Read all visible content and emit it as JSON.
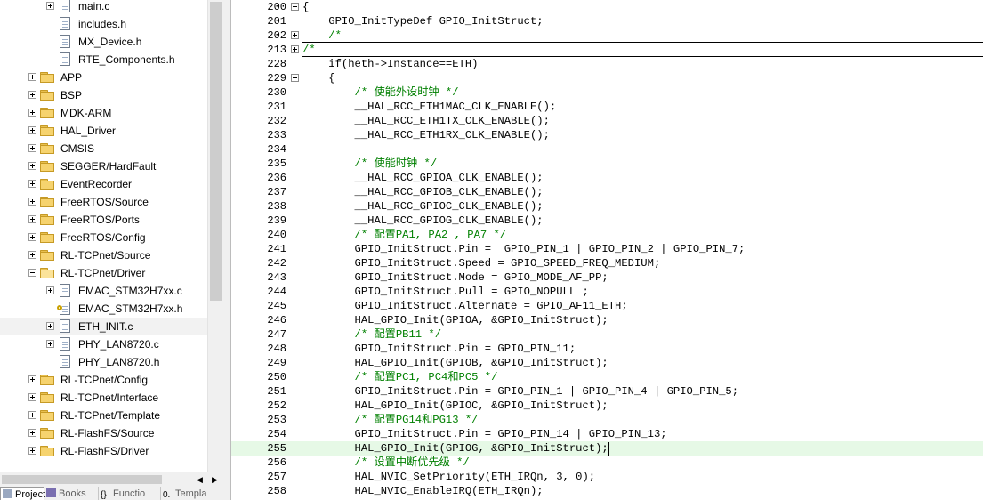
{
  "project_tree": {
    "rows": [
      {
        "indent": 2,
        "expander": "plus",
        "icon": "file",
        "label": "main.c"
      },
      {
        "indent": 2,
        "expander": "none",
        "icon": "file",
        "label": "includes.h"
      },
      {
        "indent": 2,
        "expander": "none",
        "icon": "file",
        "label": "MX_Device.h"
      },
      {
        "indent": 2,
        "expander": "none",
        "icon": "file",
        "label": "RTE_Components.h"
      },
      {
        "indent": 1,
        "expander": "plus",
        "icon": "folder",
        "label": "APP"
      },
      {
        "indent": 1,
        "expander": "plus",
        "icon": "folder",
        "label": "BSP"
      },
      {
        "indent": 1,
        "expander": "plus",
        "icon": "folder",
        "label": "MDK-ARM"
      },
      {
        "indent": 1,
        "expander": "plus",
        "icon": "folder",
        "label": "HAL_Driver"
      },
      {
        "indent": 1,
        "expander": "plus",
        "icon": "folder",
        "label": "CMSIS"
      },
      {
        "indent": 1,
        "expander": "plus",
        "icon": "folder",
        "label": "SEGGER/HardFault"
      },
      {
        "indent": 1,
        "expander": "plus",
        "icon": "folder",
        "label": "EventRecorder"
      },
      {
        "indent": 1,
        "expander": "plus",
        "icon": "folder",
        "label": "FreeRTOS/Source"
      },
      {
        "indent": 1,
        "expander": "plus",
        "icon": "folder",
        "label": "FreeRTOS/Ports"
      },
      {
        "indent": 1,
        "expander": "plus",
        "icon": "folder",
        "label": "FreeRTOS/Config"
      },
      {
        "indent": 1,
        "expander": "plus",
        "icon": "folder",
        "label": "RL-TCPnet/Source"
      },
      {
        "indent": 1,
        "expander": "minus",
        "icon": "folder-open",
        "label": "RL-TCPnet/Driver"
      },
      {
        "indent": 2,
        "expander": "plus",
        "icon": "file",
        "label": "EMAC_STM32H7xx.c"
      },
      {
        "indent": 2,
        "expander": "none",
        "icon": "file-key",
        "label": "EMAC_STM32H7xx.h"
      },
      {
        "indent": 2,
        "expander": "plus",
        "icon": "file",
        "label": "ETH_INIT.c",
        "selected": true
      },
      {
        "indent": 2,
        "expander": "plus",
        "icon": "file",
        "label": "PHY_LAN8720.c"
      },
      {
        "indent": 2,
        "expander": "none",
        "icon": "file",
        "label": "PHY_LAN8720.h"
      },
      {
        "indent": 1,
        "expander": "plus",
        "icon": "folder",
        "label": "RL-TCPnet/Config"
      },
      {
        "indent": 1,
        "expander": "plus",
        "icon": "folder",
        "label": "RL-TCPnet/Interface"
      },
      {
        "indent": 1,
        "expander": "plus",
        "icon": "folder",
        "label": "RL-TCPnet/Template"
      },
      {
        "indent": 1,
        "expander": "plus",
        "icon": "folder",
        "label": "RL-FlashFS/Source"
      },
      {
        "indent": 1,
        "expander": "plus",
        "icon": "folder",
        "label": "RL-FlashFS/Driver"
      }
    ]
  },
  "bottom_tabs": [
    {
      "label": "Project",
      "icon": "project-icon",
      "active": true
    },
    {
      "label": "Books",
      "icon": "books-icon"
    },
    {
      "label": "Functio",
      "icon": "functions-icon"
    },
    {
      "label": "Templa",
      "icon": "templates-icon"
    }
  ],
  "editor": {
    "current_line": "255",
    "lines": [
      {
        "num": "200",
        "fold": "minus",
        "text": "{"
      },
      {
        "num": "201",
        "text": "    GPIO_InitTypeDef GPIO_InitStruct;"
      },
      {
        "num": "202",
        "fold": "plus",
        "text": "    /*",
        "style": "comment",
        "separator_after": true
      },
      {
        "num": "213",
        "fold": "plus",
        "text": "/*",
        "style": "comment",
        "separator_after": true
      },
      {
        "num": "228",
        "text": "    if(heth->Instance==ETH)"
      },
      {
        "num": "229",
        "fold": "minus",
        "text": "    {"
      },
      {
        "num": "230",
        "text": "        /* 使能外设时钟 */",
        "style": "comment"
      },
      {
        "num": "231",
        "text": "        __HAL_RCC_ETH1MAC_CLK_ENABLE();"
      },
      {
        "num": "232",
        "text": "        __HAL_RCC_ETH1TX_CLK_ENABLE();"
      },
      {
        "num": "233",
        "text": "        __HAL_RCC_ETH1RX_CLK_ENABLE();"
      },
      {
        "num": "234",
        "text": ""
      },
      {
        "num": "235",
        "text": "        /* 使能时钟 */",
        "style": "comment"
      },
      {
        "num": "236",
        "text": "        __HAL_RCC_GPIOA_CLK_ENABLE();"
      },
      {
        "num": "237",
        "text": "        __HAL_RCC_GPIOB_CLK_ENABLE();"
      },
      {
        "num": "238",
        "text": "        __HAL_RCC_GPIOC_CLK_ENABLE();"
      },
      {
        "num": "239",
        "text": "        __HAL_RCC_GPIOG_CLK_ENABLE();"
      },
      {
        "num": "240",
        "text": "        /* 配置PA1, PA2 , PA7 */",
        "style": "comment"
      },
      {
        "num": "241",
        "text": "        GPIO_InitStruct.Pin =  GPIO_PIN_1 | GPIO_PIN_2 | GPIO_PIN_7;"
      },
      {
        "num": "242",
        "text": "        GPIO_InitStruct.Speed = GPIO_SPEED_FREQ_MEDIUM;"
      },
      {
        "num": "243",
        "text": "        GPIO_InitStruct.Mode = GPIO_MODE_AF_PP;"
      },
      {
        "num": "244",
        "text": "        GPIO_InitStruct.Pull = GPIO_NOPULL ;"
      },
      {
        "num": "245",
        "text": "        GPIO_InitStruct.Alternate = GPIO_AF11_ETH;"
      },
      {
        "num": "246",
        "text": "        HAL_GPIO_Init(GPIOA, &GPIO_InitStruct);"
      },
      {
        "num": "247",
        "text": "        /* 配置PB11 */",
        "style": "comment"
      },
      {
        "num": "248",
        "text": "        GPIO_InitStruct.Pin = GPIO_PIN_11;"
      },
      {
        "num": "249",
        "text": "        HAL_GPIO_Init(GPIOB, &GPIO_InitStruct);"
      },
      {
        "num": "250",
        "text": "        /* 配置PC1, PC4和PC5 */",
        "style": "comment"
      },
      {
        "num": "251",
        "text": "        GPIO_InitStruct.Pin = GPIO_PIN_1 | GPIO_PIN_4 | GPIO_PIN_5;"
      },
      {
        "num": "252",
        "text": "        HAL_GPIO_Init(GPIOC, &GPIO_InitStruct);"
      },
      {
        "num": "253",
        "text": "        /* 配置PG14和PG13 */",
        "style": "comment"
      },
      {
        "num": "254",
        "text": "        GPIO_InitStruct.Pin = GPIO_PIN_14 | GPIO_PIN_13;"
      },
      {
        "num": "255",
        "text": "        HAL_GPIO_Init(GPIOG, &GPIO_InitStruct);",
        "current": true
      },
      {
        "num": "256",
        "text": "        /* 设置中断优先级 */",
        "style": "comment"
      },
      {
        "num": "257",
        "text": "        HAL_NVIC_SetPriority(ETH_IRQn, 3, 0);"
      },
      {
        "num": "258",
        "text": "        HAL_NVIC_EnableIRQ(ETH_IRQn);"
      }
    ]
  },
  "colors": {
    "comment": "#008000",
    "current_line_bg": "#e6f9e6",
    "selected_row_bg": "#f2f2f2"
  }
}
